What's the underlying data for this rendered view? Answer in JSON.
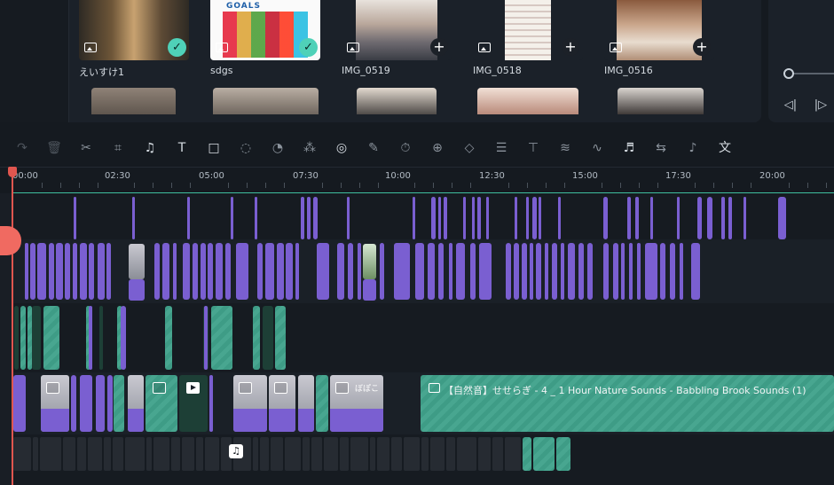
{
  "library": {
    "items": [
      {
        "name": "えいすけ1",
        "status": "added"
      },
      {
        "name": "sdgs",
        "status": "added",
        "thumb_text": "GOALS"
      },
      {
        "name": "IMG_0519",
        "status": "new"
      },
      {
        "name": "IMG_0518",
        "status": "new"
      },
      {
        "name": "IMG_0516",
        "status": "new"
      }
    ],
    "add_glyph": "+",
    "check_glyph": "✓"
  },
  "preview": {
    "prev_frame_glyph": "◁|",
    "play_glyph": "|▷"
  },
  "toolbar": {
    "tools": [
      {
        "icon": "redo-icon",
        "glyph": "↷"
      },
      {
        "icon": "delete-icon",
        "glyph": "🗑"
      },
      {
        "icon": "scissors-icon",
        "glyph": "✂"
      },
      {
        "icon": "crop-icon",
        "glyph": "⌗"
      },
      {
        "icon": "audio-icon",
        "glyph": "♫"
      },
      {
        "icon": "text-icon",
        "glyph": "T"
      },
      {
        "icon": "shape-icon",
        "glyph": "□"
      },
      {
        "icon": "mask-icon",
        "glyph": "◌"
      },
      {
        "icon": "speed-icon",
        "glyph": "◔"
      },
      {
        "icon": "color-icon",
        "glyph": "⁂"
      },
      {
        "icon": "ai-tool-icon",
        "glyph": "◎"
      },
      {
        "icon": "edit-icon",
        "glyph": "✎"
      },
      {
        "icon": "timer-icon",
        "glyph": "⏱"
      },
      {
        "icon": "stabilize-icon",
        "glyph": "⊕"
      },
      {
        "icon": "keyframe-icon",
        "glyph": "◇"
      },
      {
        "icon": "adjust-icon",
        "glyph": "☰"
      },
      {
        "icon": "text-ai-icon",
        "glyph": "⊤"
      },
      {
        "icon": "waveform-icon",
        "glyph": "≋"
      },
      {
        "icon": "audio-stretch-icon",
        "glyph": "∿"
      },
      {
        "icon": "beat-icon",
        "glyph": "♬"
      },
      {
        "icon": "subtitle-icon",
        "glyph": "⇆"
      },
      {
        "icon": "voice-icon",
        "glyph": "♪"
      },
      {
        "icon": "translate-icon",
        "glyph": "文"
      },
      {
        "icon": "fit-icon",
        "glyph": "▣"
      }
    ]
  },
  "ruler": {
    "ticks": [
      "00:00",
      "02:30",
      "05:00",
      "07:30",
      "10:00",
      "12:30",
      "15:00",
      "17:30",
      "20:00"
    ]
  },
  "timeline": {
    "long_clip_title": "【自然音】せせらぎ - 4 _ 1 Hour Nature Sounds - Babbling Brook Sounds (1)",
    "thumb_text": "ぼぽこ"
  },
  "colors": {
    "accent": "#3fbf9f",
    "video_clip": "#7a5fd1",
    "green_clip": "#48a690",
    "playhead": "#e0564f"
  }
}
